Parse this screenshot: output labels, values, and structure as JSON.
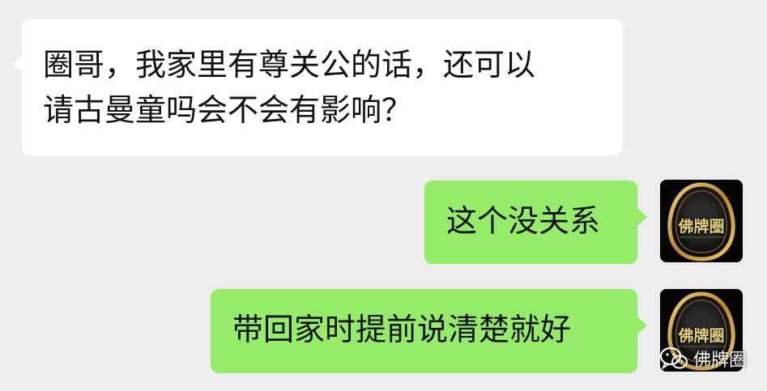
{
  "messages": [
    {
      "side": "incoming",
      "lines": [
        "圈哥，我家里有尊关公的话，还可以",
        "请古曼童吗会不会有影响？"
      ]
    },
    {
      "side": "outgoing",
      "text": "这个没关系"
    },
    {
      "side": "outgoing",
      "text": "带回家时提前说清楚就好"
    }
  ],
  "avatar": {
    "label": "佛牌圈"
  },
  "watermark": {
    "text": "佛牌圈",
    "icon": "wechat-icon"
  },
  "colors": {
    "background": "#ededed",
    "incoming_bubble": "#ffffff",
    "outgoing_bubble": "#95ec69",
    "avatar_gold": "#c9a24a"
  }
}
